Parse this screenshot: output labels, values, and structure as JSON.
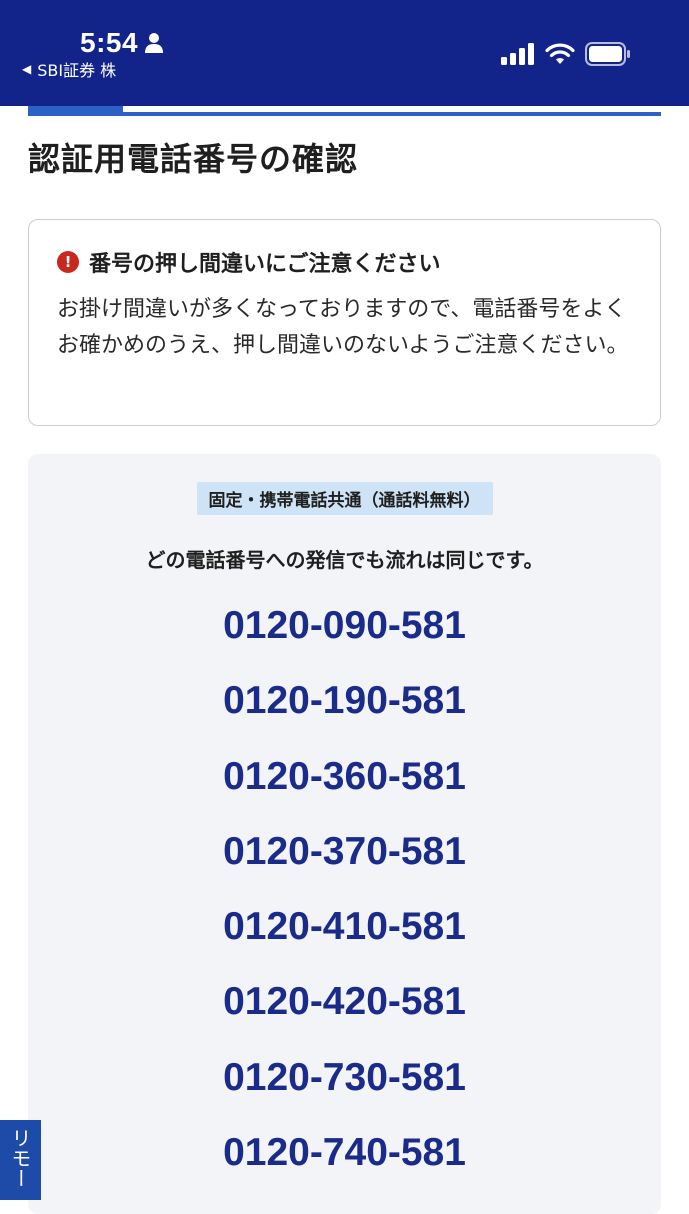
{
  "status_bar": {
    "time": "5:54",
    "back_app": "SBI証券 株",
    "icons": [
      "person-icon",
      "signal-icon",
      "wifi-icon",
      "battery-icon"
    ]
  },
  "page": {
    "title": "認証用電話番号の確認"
  },
  "progress": {
    "fraction": 0.15
  },
  "notice": {
    "icon": "alert-icon",
    "icon_glyph": "!",
    "heading": "番号の押し間違いにご注意ください",
    "body": "お掛け間違いが多くなっておりますので、電話番号をよくお確かめのうえ、押し間違いのないようご注意ください。"
  },
  "phone_panel": {
    "tag": "固定・携帯電話共通（通話料無料）",
    "subtitle": "どの電話番号への発信でも流れは同じです。",
    "numbers": [
      "0120-090-581",
      "0120-190-581",
      "0120-360-581",
      "0120-370-581",
      "0120-410-581",
      "0120-420-581",
      "0120-730-581",
      "0120-740-581"
    ]
  },
  "side_tab": {
    "label": "リモー"
  },
  "colors": {
    "status_bar_bg": "#12238a",
    "accent": "#2c61c5",
    "phone_number": "#1a2b8a",
    "alert": "#c8281e",
    "tag_bg": "#cfe3f7",
    "panel_bg": "#f2f4f8"
  }
}
